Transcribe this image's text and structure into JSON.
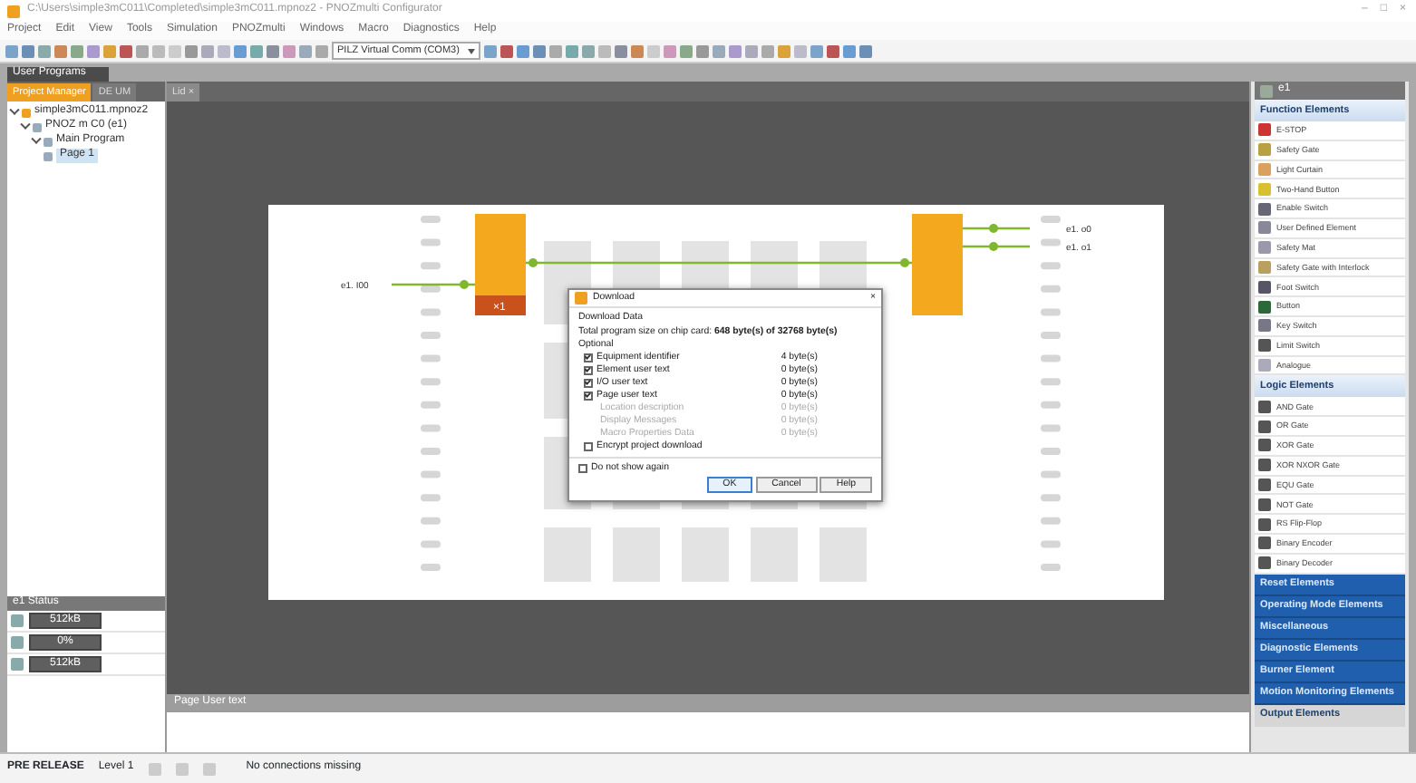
{
  "window": {
    "title": "C:\\Users\\simple3mC011\\Completed\\simple3mC011.mpnoz2 - PNOZmulti Configurator",
    "controls": [
      "–",
      "□",
      "×"
    ]
  },
  "menu": [
    "Project",
    "Edit",
    "View",
    "Tools",
    "Simulation",
    "PNOZmulti",
    "Windows",
    "Macro",
    "Diagnostics",
    "Help"
  ],
  "toolbar": {
    "connection": "PILZ Virtual Comm (COM3)"
  },
  "user_programs": {
    "title": "User Programs"
  },
  "left_tabs": [
    {
      "label": "Project Manager",
      "selected": true
    },
    {
      "label": "DE UM",
      "selected": false
    }
  ],
  "tree": [
    {
      "label": "simple3mC011.mpnoz2",
      "expanded": true,
      "selected": false,
      "children": [
        {
          "label": "PNOZ m C0 (e1)",
          "expanded": true,
          "selected": false,
          "children": [
            {
              "label": "Main Program",
              "expanded": true,
              "selected": false,
              "children": [
                {
                  "label": "Page 1",
                  "selected": true
                }
              ]
            }
          ]
        }
      ]
    }
  ],
  "editor_tabs": [
    {
      "label": "Lid",
      "close": "×",
      "selected": true
    }
  ],
  "canvas": {
    "input_label": "e1. I00",
    "output_labels": [
      "e1. o0",
      "e1. o1"
    ],
    "block_label": "×1"
  },
  "dialog": {
    "title": "Download",
    "close": "×",
    "section": "Download Data",
    "total": "Total program size on chip card: **648 byte(s) of 32768 byte(s)**",
    "optional": "Optional",
    "items": [
      {
        "label": "Equipment identifier",
        "size": "4 byte(s)",
        "checked": true,
        "disabled": false
      },
      {
        "label": "Element user text",
        "size": "0 byte(s)",
        "checked": true,
        "disabled": false
      },
      {
        "label": "I/O user text",
        "size": "0 byte(s)",
        "checked": true,
        "disabled": false
      },
      {
        "label": "Page user text",
        "size": "0 byte(s)",
        "checked": true,
        "disabled": false
      },
      {
        "label": "Location description",
        "size": "0 byte(s)",
        "disabled": true
      },
      {
        "label": "Display Messages",
        "size": "0 byte(s)",
        "disabled": true
      },
      {
        "label": "Macro Properties Data",
        "size": "0 byte(s)",
        "disabled": true
      }
    ],
    "encrypt": {
      "label": "Encrypt project download",
      "checked": false
    },
    "dont_show": {
      "label": "Do not show again",
      "checked": false
    },
    "buttons": [
      "OK",
      "Cancel",
      "Help"
    ]
  },
  "status_panel": {
    "title": "e1 Status",
    "rows": [
      "512kB",
      "0%",
      "512kB"
    ]
  },
  "page_user_text": {
    "title": "Page User text"
  },
  "right_panel": {
    "title": "e1",
    "sections": [
      {
        "title": "Function Elements",
        "expanded": true,
        "items": [
          "E-STOP",
          "Safety Gate",
          "Light Curtain",
          "Two-Hand Button",
          "Enable Switch",
          "User Defined Element",
          "Safety Mat",
          "Safety Gate with Interlock",
          "Foot Switch",
          "Button",
          "Key Switch",
          "Limit Switch",
          "Analogue"
        ]
      },
      {
        "title": "Logic Elements",
        "expanded": true,
        "items": [
          "AND Gate",
          "OR Gate",
          "XOR Gate",
          "XOR NXOR Gate",
          "EQU Gate",
          "NOT Gate",
          "RS Flip-Flop",
          "Binary Encoder",
          "Binary Decoder"
        ]
      },
      {
        "title": "Reset Elements",
        "expanded": false
      },
      {
        "title": "Operating Mode Elements",
        "expanded": false
      },
      {
        "title": "Miscellaneous",
        "expanded": false
      },
      {
        "title": "Diagnostic Elements",
        "expanded": false
      },
      {
        "title": "Burner Element",
        "expanded": false
      },
      {
        "title": "Motion Monitoring Elements",
        "expanded": false
      },
      {
        "title": "Output Elements",
        "expanded": false,
        "kind": "plain"
      }
    ]
  },
  "status_bar": {
    "release": "PRE RELEASE",
    "level": "Level 1",
    "message": "No connections missing"
  }
}
